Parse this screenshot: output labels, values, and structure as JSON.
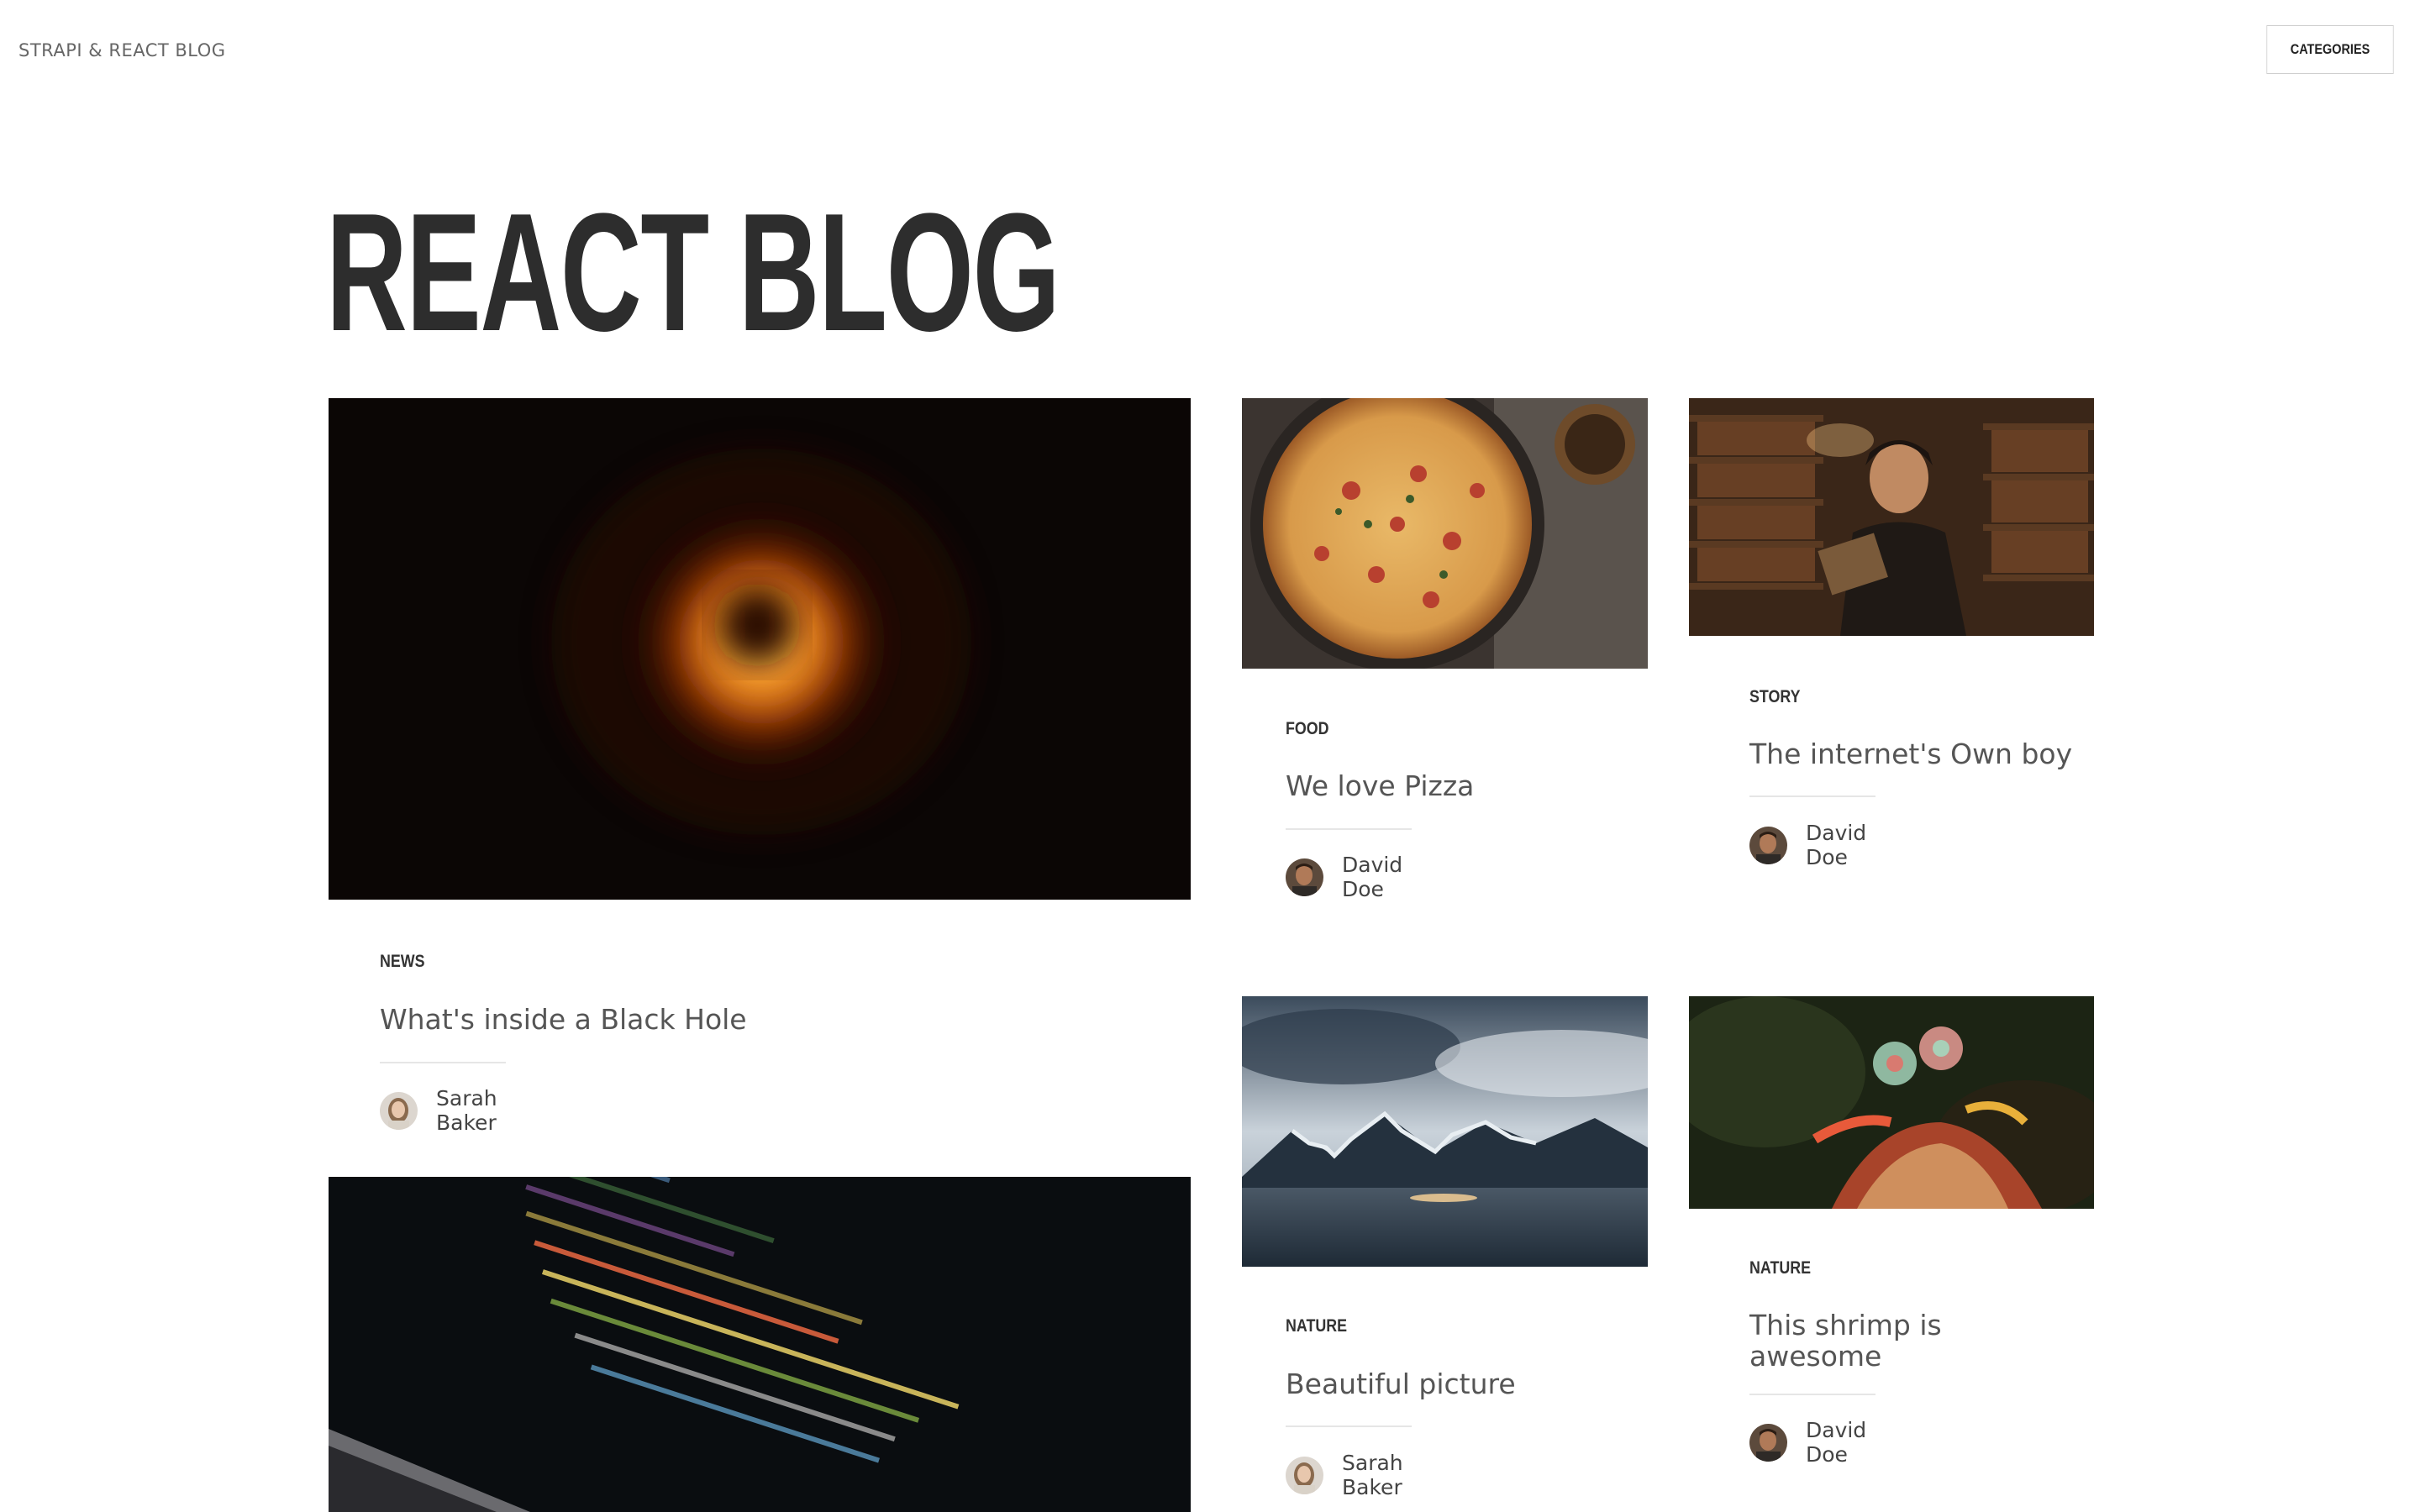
{
  "header": {
    "brand": "STRAPI & REACT BLOG",
    "categories_button": "CATEGORIES"
  },
  "page": {
    "title": "REACT BLOG"
  },
  "articles": [
    {
      "category": "NEWS",
      "title": "What's inside a Black Hole",
      "author": "Sarah Baker",
      "image": "black-hole-image"
    },
    {
      "category": "FOOD",
      "title": "We love Pizza",
      "author": "David Doe",
      "image": "pizza-image"
    },
    {
      "category": "STORY",
      "title": "The internet's Own boy",
      "author": "David Doe",
      "image": "library-man-image"
    },
    {
      "category": "NATURE",
      "title": "Beautiful picture",
      "author": "Sarah Baker",
      "image": "mountains-image"
    },
    {
      "category": "NATURE",
      "title": "This shrimp is awesome",
      "author": "David Doe",
      "image": "mantis-shrimp-image"
    },
    {
      "category": "",
      "title": "",
      "author": "",
      "image": "code-laptop-image"
    }
  ],
  "colors": {
    "title": "#2d2d2d",
    "text": "#555555",
    "border": "#cfcfcf"
  }
}
